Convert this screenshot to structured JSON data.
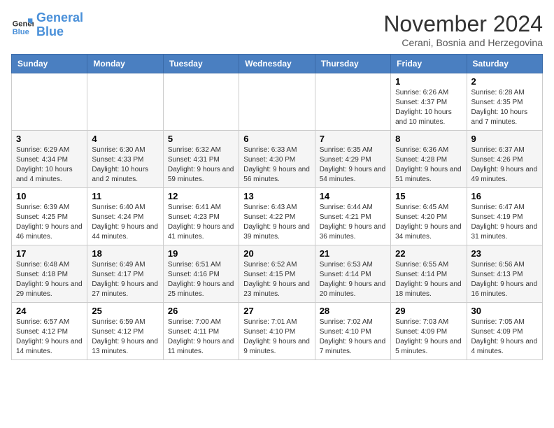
{
  "header": {
    "logo_text_general": "General",
    "logo_text_blue": "Blue",
    "month_title": "November 2024",
    "location": "Cerani, Bosnia and Herzegovina"
  },
  "weekdays": [
    "Sunday",
    "Monday",
    "Tuesday",
    "Wednesday",
    "Thursday",
    "Friday",
    "Saturday"
  ],
  "weeks": [
    [
      {
        "day": "",
        "info": ""
      },
      {
        "day": "",
        "info": ""
      },
      {
        "day": "",
        "info": ""
      },
      {
        "day": "",
        "info": ""
      },
      {
        "day": "",
        "info": ""
      },
      {
        "day": "1",
        "info": "Sunrise: 6:26 AM\nSunset: 4:37 PM\nDaylight: 10 hours and 10 minutes."
      },
      {
        "day": "2",
        "info": "Sunrise: 6:28 AM\nSunset: 4:35 PM\nDaylight: 10 hours and 7 minutes."
      }
    ],
    [
      {
        "day": "3",
        "info": "Sunrise: 6:29 AM\nSunset: 4:34 PM\nDaylight: 10 hours and 4 minutes."
      },
      {
        "day": "4",
        "info": "Sunrise: 6:30 AM\nSunset: 4:33 PM\nDaylight: 10 hours and 2 minutes."
      },
      {
        "day": "5",
        "info": "Sunrise: 6:32 AM\nSunset: 4:31 PM\nDaylight: 9 hours and 59 minutes."
      },
      {
        "day": "6",
        "info": "Sunrise: 6:33 AM\nSunset: 4:30 PM\nDaylight: 9 hours and 56 minutes."
      },
      {
        "day": "7",
        "info": "Sunrise: 6:35 AM\nSunset: 4:29 PM\nDaylight: 9 hours and 54 minutes."
      },
      {
        "day": "8",
        "info": "Sunrise: 6:36 AM\nSunset: 4:28 PM\nDaylight: 9 hours and 51 minutes."
      },
      {
        "day": "9",
        "info": "Sunrise: 6:37 AM\nSunset: 4:26 PM\nDaylight: 9 hours and 49 minutes."
      }
    ],
    [
      {
        "day": "10",
        "info": "Sunrise: 6:39 AM\nSunset: 4:25 PM\nDaylight: 9 hours and 46 minutes."
      },
      {
        "day": "11",
        "info": "Sunrise: 6:40 AM\nSunset: 4:24 PM\nDaylight: 9 hours and 44 minutes."
      },
      {
        "day": "12",
        "info": "Sunrise: 6:41 AM\nSunset: 4:23 PM\nDaylight: 9 hours and 41 minutes."
      },
      {
        "day": "13",
        "info": "Sunrise: 6:43 AM\nSunset: 4:22 PM\nDaylight: 9 hours and 39 minutes."
      },
      {
        "day": "14",
        "info": "Sunrise: 6:44 AM\nSunset: 4:21 PM\nDaylight: 9 hours and 36 minutes."
      },
      {
        "day": "15",
        "info": "Sunrise: 6:45 AM\nSunset: 4:20 PM\nDaylight: 9 hours and 34 minutes."
      },
      {
        "day": "16",
        "info": "Sunrise: 6:47 AM\nSunset: 4:19 PM\nDaylight: 9 hours and 31 minutes."
      }
    ],
    [
      {
        "day": "17",
        "info": "Sunrise: 6:48 AM\nSunset: 4:18 PM\nDaylight: 9 hours and 29 minutes."
      },
      {
        "day": "18",
        "info": "Sunrise: 6:49 AM\nSunset: 4:17 PM\nDaylight: 9 hours and 27 minutes."
      },
      {
        "day": "19",
        "info": "Sunrise: 6:51 AM\nSunset: 4:16 PM\nDaylight: 9 hours and 25 minutes."
      },
      {
        "day": "20",
        "info": "Sunrise: 6:52 AM\nSunset: 4:15 PM\nDaylight: 9 hours and 23 minutes."
      },
      {
        "day": "21",
        "info": "Sunrise: 6:53 AM\nSunset: 4:14 PM\nDaylight: 9 hours and 20 minutes."
      },
      {
        "day": "22",
        "info": "Sunrise: 6:55 AM\nSunset: 4:14 PM\nDaylight: 9 hours and 18 minutes."
      },
      {
        "day": "23",
        "info": "Sunrise: 6:56 AM\nSunset: 4:13 PM\nDaylight: 9 hours and 16 minutes."
      }
    ],
    [
      {
        "day": "24",
        "info": "Sunrise: 6:57 AM\nSunset: 4:12 PM\nDaylight: 9 hours and 14 minutes."
      },
      {
        "day": "25",
        "info": "Sunrise: 6:59 AM\nSunset: 4:12 PM\nDaylight: 9 hours and 13 minutes."
      },
      {
        "day": "26",
        "info": "Sunrise: 7:00 AM\nSunset: 4:11 PM\nDaylight: 9 hours and 11 minutes."
      },
      {
        "day": "27",
        "info": "Sunrise: 7:01 AM\nSunset: 4:10 PM\nDaylight: 9 hours and 9 minutes."
      },
      {
        "day": "28",
        "info": "Sunrise: 7:02 AM\nSunset: 4:10 PM\nDaylight: 9 hours and 7 minutes."
      },
      {
        "day": "29",
        "info": "Sunrise: 7:03 AM\nSunset: 4:09 PM\nDaylight: 9 hours and 5 minutes."
      },
      {
        "day": "30",
        "info": "Sunrise: 7:05 AM\nSunset: 4:09 PM\nDaylight: 9 hours and 4 minutes."
      }
    ]
  ]
}
